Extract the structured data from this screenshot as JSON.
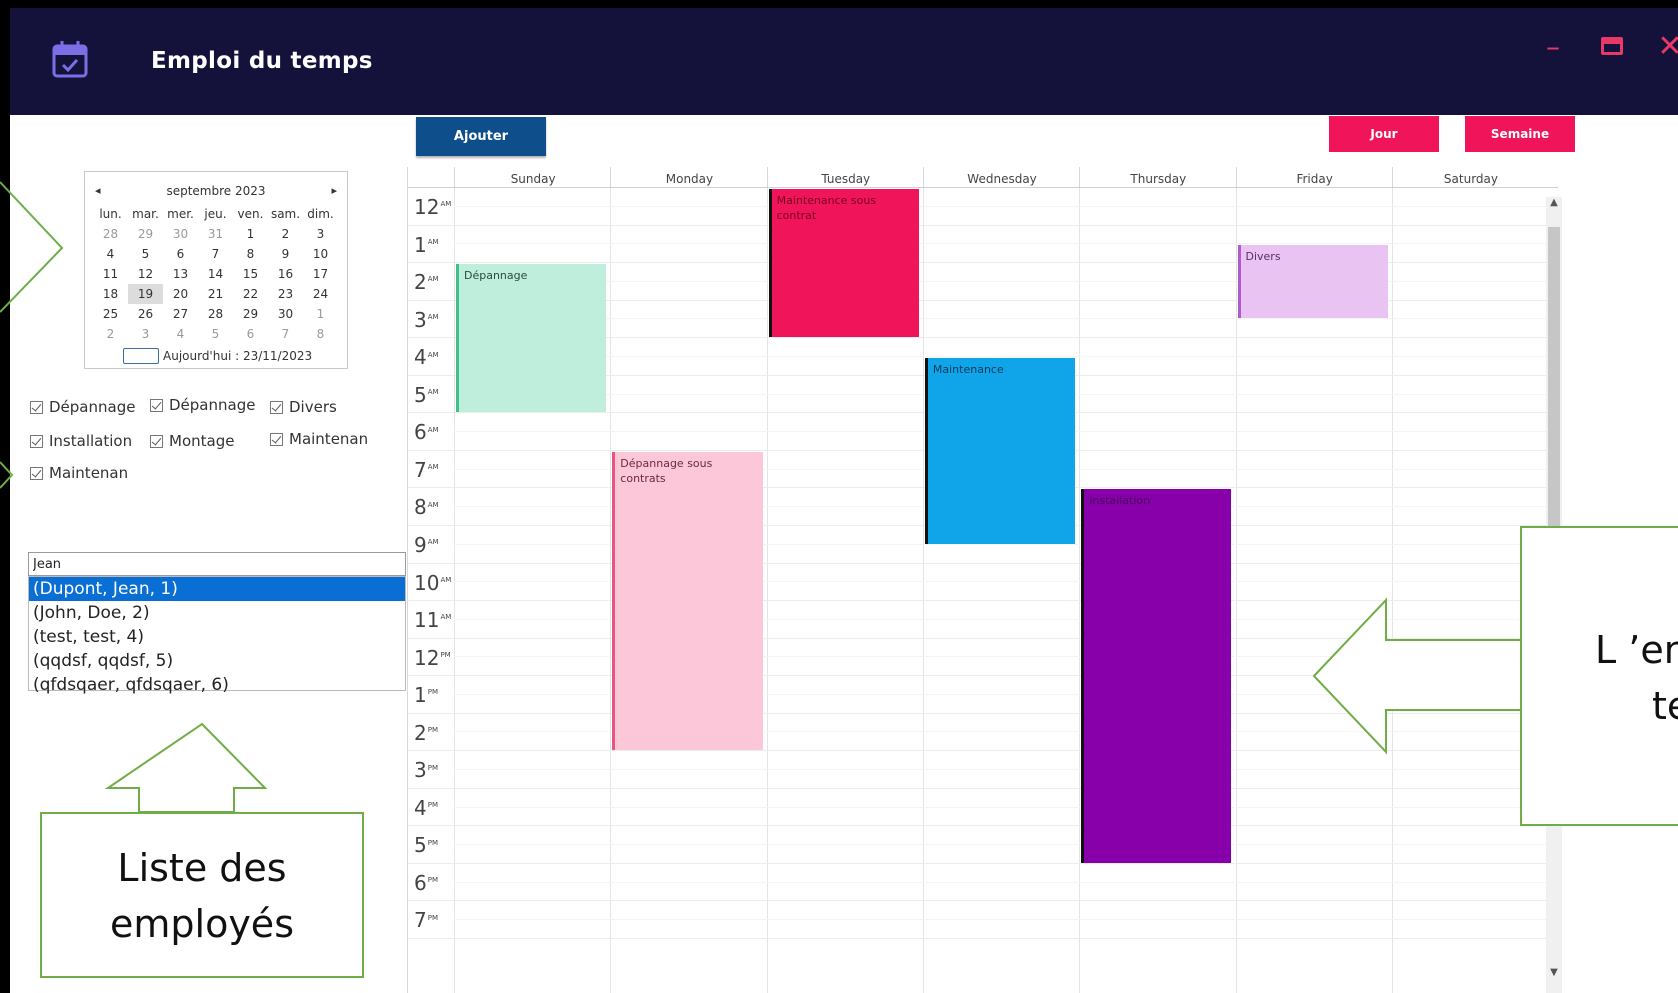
{
  "window": {
    "title": "Emploi du temps",
    "icons": {
      "app": "calendar-check-icon",
      "minimize": "minimize-icon",
      "maximize": "maximize-icon",
      "close": "close-icon"
    },
    "controls": {
      "minimize": "–",
      "close": "✕"
    }
  },
  "toolbar": {
    "add_label": "Ajouter",
    "day_label": "Jour",
    "week_label": "Semaine"
  },
  "mini_calendar": {
    "prev": "◂",
    "next": "▸",
    "month_label": "septembre 2023",
    "weekdays": [
      "lun.",
      "mar.",
      "mer.",
      "jeu.",
      "ven.",
      "sam.",
      "dim."
    ],
    "weeks": [
      [
        "28",
        "29",
        "30",
        "31",
        "1",
        "2",
        "3"
      ],
      [
        "4",
        "5",
        "6",
        "7",
        "8",
        "9",
        "10"
      ],
      [
        "11",
        "12",
        "13",
        "14",
        "15",
        "16",
        "17"
      ],
      [
        "18",
        "19",
        "20",
        "21",
        "22",
        "23",
        "24"
      ],
      [
        "25",
        "26",
        "27",
        "28",
        "29",
        "30",
        "1"
      ],
      [
        "2",
        "3",
        "4",
        "5",
        "6",
        "7",
        "8"
      ]
    ],
    "selected_day": "19",
    "today_label": "Aujourd'hui : 23/11/2023"
  },
  "filters": [
    "Dépannage",
    "Dépannage",
    "Divers",
    "Installation",
    "Montage",
    "Maintenan",
    "Maintenan"
  ],
  "employees": {
    "search_value": "Jean",
    "items": [
      "(Dupont, Jean, 1)",
      "(John, Doe, 2)",
      "(test, test, 4)",
      "(qqdsf, qqdsf, 5)",
      "(qfdsqaer, qfdsqaer, 6)"
    ],
    "selected_index": 0
  },
  "week": {
    "days": [
      "Sunday",
      "Monday",
      "Tuesday",
      "Wednesday",
      "Thursday",
      "Friday",
      "Saturday"
    ],
    "hours": [
      {
        "h": "12",
        "s": "AM"
      },
      {
        "h": "1",
        "s": "AM"
      },
      {
        "h": "2",
        "s": "AM"
      },
      {
        "h": "3",
        "s": "AM"
      },
      {
        "h": "4",
        "s": "AM"
      },
      {
        "h": "5",
        "s": "AM"
      },
      {
        "h": "6",
        "s": "AM"
      },
      {
        "h": "7",
        "s": "AM"
      },
      {
        "h": "8",
        "s": "AM"
      },
      {
        "h": "9",
        "s": "AM"
      },
      {
        "h": "10",
        "s": "AM"
      },
      {
        "h": "11",
        "s": "AM"
      },
      {
        "h": "12",
        "s": "PM"
      },
      {
        "h": "1",
        "s": "PM"
      },
      {
        "h": "2",
        "s": "PM"
      },
      {
        "h": "3",
        "s": "PM"
      },
      {
        "h": "4",
        "s": "PM"
      },
      {
        "h": "5",
        "s": "PM"
      },
      {
        "h": "6",
        "s": "PM"
      },
      {
        "h": "7",
        "s": "PM"
      }
    ],
    "events": [
      {
        "label": "Maintenance sous contrat",
        "day": 2,
        "start": 0,
        "end": 4,
        "color": "#f0145a",
        "border": "#111111",
        "text": "#7a0020"
      },
      {
        "label": "Dépannage",
        "day": 0,
        "start": 2,
        "end": 6,
        "color": "#bfeedd",
        "border": "#3fbf8a",
        "text": "#2a4a3a"
      },
      {
        "label": "Divers",
        "day": 5,
        "start": 1.5,
        "end": 3.5,
        "color": "#e9c4f3",
        "border": "#b05ad0",
        "text": "#5a2a6a"
      },
      {
        "label": "Maintenance",
        "day": 3,
        "start": 4.5,
        "end": 9.5,
        "color": "#0fa5e8",
        "border": "#111111",
        "text": "#0a3a60"
      },
      {
        "label": "Dépannage sous contrats",
        "day": 1,
        "start": 7,
        "end": 15,
        "color": "#fcc8d9",
        "border": "#e8557f",
        "text": "#6a2a3a"
      },
      {
        "label": "Installation",
        "day": 4,
        "start": 8,
        "end": 18,
        "color": "#8800aa",
        "border": "#111111",
        "text": "#4a0060"
      }
    ]
  },
  "annotations": {
    "employees_label": "Liste des employés",
    "schedule_label_line1": "L ’em",
    "schedule_label_line2": "te"
  }
}
